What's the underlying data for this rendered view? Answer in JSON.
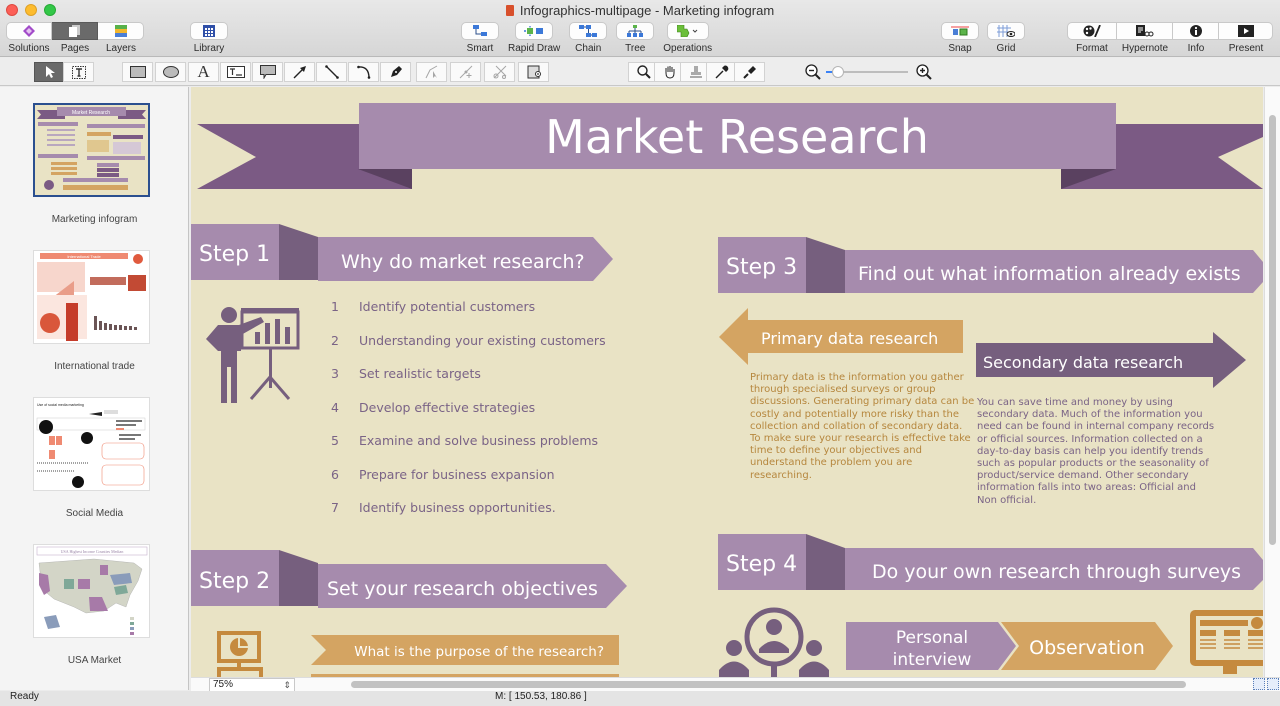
{
  "window": {
    "title": "Infographics-multipage - Marketing infogram"
  },
  "toolbar": {
    "left_group": [
      {
        "label": "Solutions",
        "icon": "solutions-icon",
        "active": false
      },
      {
        "label": "Pages",
        "icon": "pages-icon",
        "active": true
      },
      {
        "label": "Layers",
        "icon": "layers-icon",
        "active": false
      }
    ],
    "library": {
      "label": "Library",
      "icon": "library-icon"
    },
    "center_group": [
      {
        "label": "Smart",
        "icon": "smart-connector-icon"
      },
      {
        "label": "Rapid Draw",
        "icon": "rapid-draw-icon"
      },
      {
        "label": "Chain",
        "icon": "chain-icon"
      },
      {
        "label": "Tree",
        "icon": "tree-icon"
      },
      {
        "label": "Operations",
        "icon": "operations-icon"
      }
    ],
    "snap_grid": [
      {
        "label": "Snap",
        "icon": "snap-icon"
      },
      {
        "label": "Grid",
        "icon": "grid-icon"
      }
    ],
    "right_group": [
      {
        "label": "Format",
        "icon": "format-icon"
      },
      {
        "label": "Hypernote",
        "icon": "hypernote-icon"
      },
      {
        "label": "Info",
        "icon": "info-icon"
      },
      {
        "label": "Present",
        "icon": "present-icon"
      }
    ]
  },
  "drawing_tools": {
    "zoom_slider_value": 0.15
  },
  "sidebar": {
    "pages": [
      {
        "label": "Marketing infogram",
        "selected": true
      },
      {
        "label": "International trade",
        "selected": false
      },
      {
        "label": "Social Media",
        "selected": false
      },
      {
        "label": "USA Market",
        "selected": false
      }
    ],
    "thumb_titles": {
      "marketing": "Market Research",
      "trade": "International Trade",
      "social": "Use of social media marketing",
      "usa": "USA Highest Income Counties Median"
    }
  },
  "infographic": {
    "title": "Market Research",
    "colors": {
      "background": "#e9e3c5",
      "purple_light": "#a68bad",
      "purple_dark": "#7b5a84",
      "purple_shadow": "#5a4160",
      "gold": "#d4a462",
      "text_purple": "#7a6386",
      "text_gold": "#b6873e"
    },
    "step1": {
      "step_label": "Step 1",
      "heading": "Why do market research?",
      "items": [
        {
          "num": "1",
          "text": "Identify potential customers"
        },
        {
          "num": "2",
          "text": "Understanding your existing customers"
        },
        {
          "num": "3",
          "text": "Set realistic targets"
        },
        {
          "num": "4",
          "text": "Develop effective strategies"
        },
        {
          "num": "5",
          "text": "Examine and solve business problems"
        },
        {
          "num": "6",
          "text": "Prepare for business expansion"
        },
        {
          "num": "7",
          "text": "Identify business opportunities."
        }
      ]
    },
    "step2": {
      "step_label": "Step 2",
      "heading": "Set your research objectives",
      "question": "What is the purpose of the research?"
    },
    "step3": {
      "step_label": "Step 3",
      "heading": "Find out what information already exists",
      "primary_label": "Primary data research",
      "primary_text": "Primary data is the information you gather through specialised surveys or group discussions. Generating primary data can be costly and potentially more risky than the collection and collation of secondary data. To make sure your research is effective take time to define your objectives and understand the problem you are researching.",
      "secondary_label": "Secondary data research",
      "secondary_text": "You can save time and money by using secondary data. Much of the information you need can be found in internal company records or official sources. Information collected on a day-to-day basis can help you identify trends such as popular products or the seasonality of product/service demand. Other secondary information falls into two areas: Official and Non official."
    },
    "step4": {
      "step_label": "Step 4",
      "heading": "Do your own research through surveys",
      "method1_line1": "Personal",
      "method1_line2": "interview",
      "method2": "Observation"
    }
  },
  "bottom": {
    "zoom_value": "75%",
    "status": "Ready",
    "mouse_coords": "M: [ 150.53, 180.86 ]"
  }
}
